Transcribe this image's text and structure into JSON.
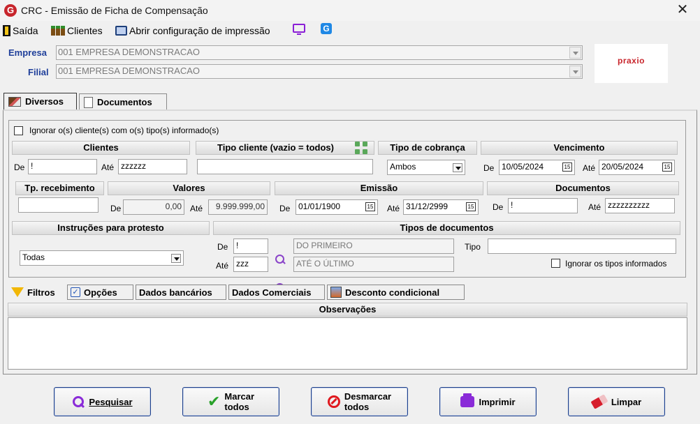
{
  "window": {
    "title": "CRC - Emissão de Ficha de Compensação",
    "app_icon": "G",
    "close": "✕"
  },
  "toolbar": {
    "exit_label": "Saída",
    "clients_label": "Clientes",
    "print_config_label": "Abrir configuração de impressão",
    "blue_g_icon": "G"
  },
  "header": {
    "empresa_label": "Empresa",
    "empresa_value": "001 EMPRESA DEMONSTRACAO",
    "filial_label": "Filial",
    "filial_value": "001 EMPRESA DEMONSTRACAO",
    "logo_text": "praxio"
  },
  "tabs": [
    {
      "label": "Diversos",
      "active": true
    },
    {
      "label": "Documentos",
      "active": false
    }
  ],
  "diversos": {
    "ignore_clients_label": "Ignorar o(s) cliente(s) com o(s) tipo(s) informado(s)",
    "clientes": {
      "title": "Clientes",
      "de_label": "De",
      "de_value": "!",
      "ate_label": "Até",
      "ate_value": "zzzzzz"
    },
    "tipo_cliente": {
      "title": "Tipo cliente (vazio = todos)",
      "value": ""
    },
    "tipo_cobranca": {
      "title": "Tipo de cobrança",
      "value": "Ambos"
    },
    "vencimento": {
      "title": "Vencimento",
      "de_label": "De",
      "de_value": "10/05/2024",
      "ate_label": "Até",
      "ate_value": "20/05/2024",
      "cal_glyph": "15"
    },
    "tp_recebimento": {
      "title": "Tp. recebimento",
      "value": ""
    },
    "valores": {
      "title": "Valores",
      "de_label": "De",
      "de_value": "0,00",
      "ate_label": "Até",
      "ate_value": "9.999.999,00"
    },
    "emissao": {
      "title": "Emissão",
      "de_label": "De",
      "de_value": "01/01/1900",
      "ate_label": "Até",
      "ate_value": "31/12/2999"
    },
    "documentos": {
      "title": "Documentos",
      "de_label": "De",
      "de_value": "!",
      "ate_label": "Até",
      "ate_value": "zzzzzzzzzz"
    },
    "instrucoes": {
      "title": "Instruções para protesto",
      "value": "Todas"
    },
    "tipos_documentos": {
      "title": "Tipos de documentos",
      "de_label": "De",
      "de_value": "!",
      "de_desc": "DO PRIMEIRO",
      "ate_label": "Até",
      "ate_value": "zzz",
      "ate_desc": "ATÉ O ÚLTIMO",
      "tipo_label": "Tipo",
      "tipo_value": "",
      "ignore_label": "Ignorar os tipos informados"
    }
  },
  "lower_tabs": [
    {
      "label": "Filtros"
    },
    {
      "label": "Opções"
    },
    {
      "label": "Dados bancários"
    },
    {
      "label": "Dados Comerciais"
    },
    {
      "label": "Desconto condicional"
    }
  ],
  "observacoes": {
    "title": "Observações"
  },
  "buttons": {
    "pesquisar": "Pesquisar",
    "marcar_line1": "Marcar",
    "marcar_line2": "todos",
    "desmarcar_line1": "Desmarcar",
    "desmarcar_line2": "todos",
    "imprimir": "Imprimir",
    "limpar": "Limpar"
  },
  "colors": {
    "accent_blue": "#1f3f9a",
    "brand_red": "#c8242b",
    "button_border": "#1d3f8a",
    "icon_purple": "#8a2bd8"
  }
}
